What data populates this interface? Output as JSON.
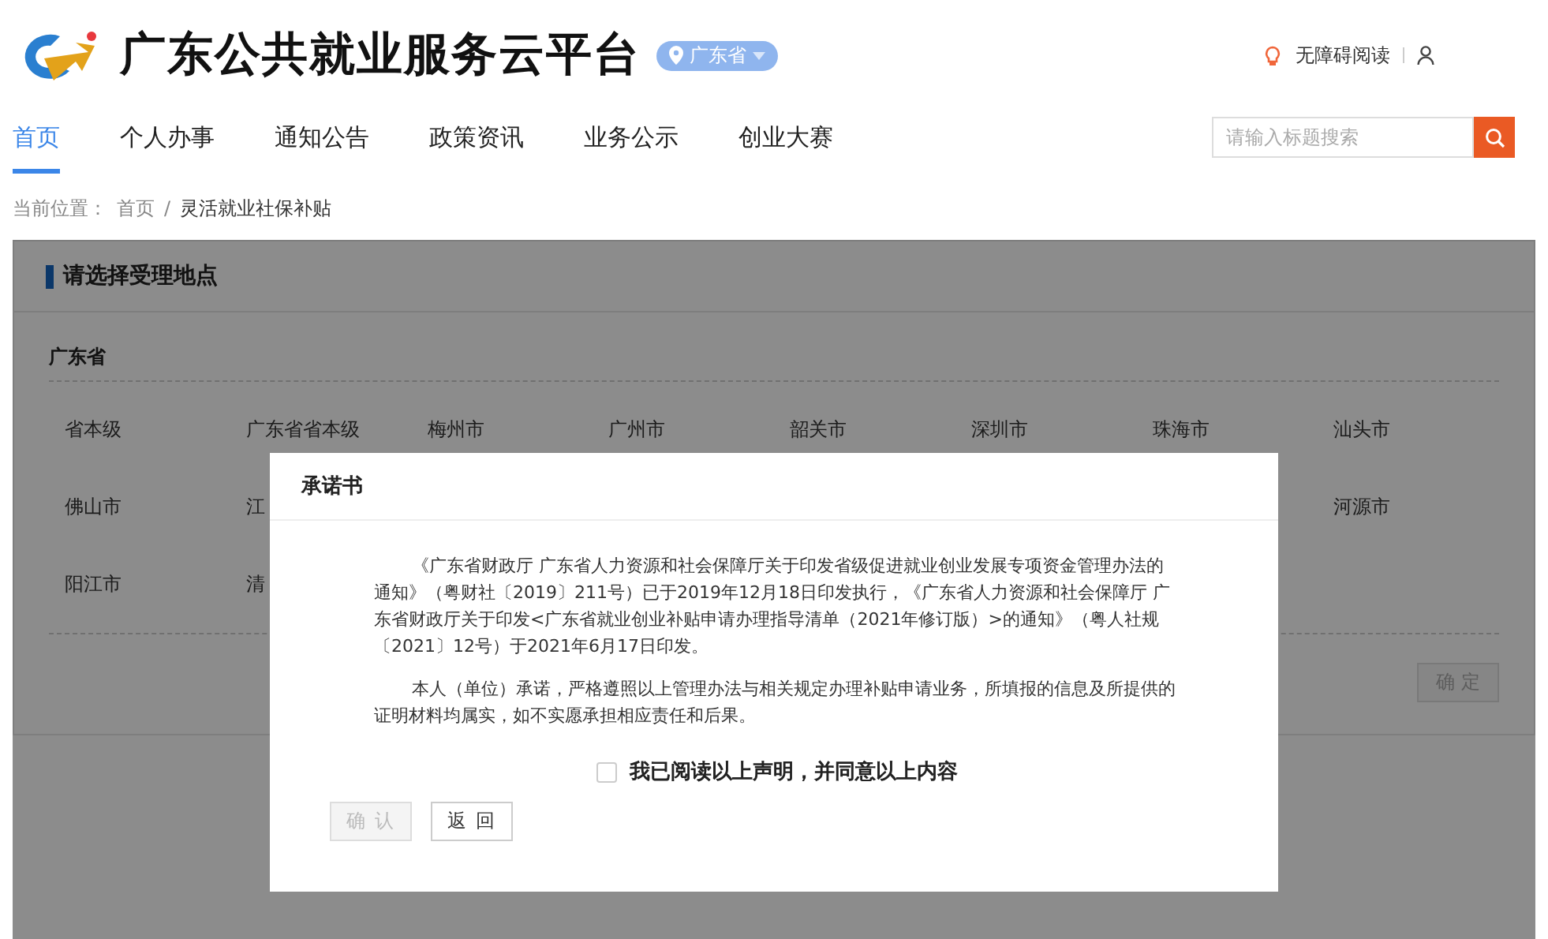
{
  "header": {
    "title": "广东公共就业服务云平台",
    "region": "广东省",
    "accessibility": "无障碍阅读"
  },
  "nav": [
    {
      "label": "首页",
      "selected": true
    },
    {
      "label": "个人办事",
      "selected": false
    },
    {
      "label": "通知公告",
      "selected": false
    },
    {
      "label": "政策资讯",
      "selected": false
    },
    {
      "label": "业务公示",
      "selected": false
    },
    {
      "label": "创业大赛",
      "selected": false
    }
  ],
  "search": {
    "placeholder": "请输入标题搜索"
  },
  "breadcrumb": {
    "label": "当前位置：",
    "items": [
      "首页",
      "灵活就业社保补贴"
    ],
    "separator": "/"
  },
  "location_panel": {
    "title": "请选择受理地点",
    "province": "广东省",
    "rows": [
      {
        "left": [
          "省本级",
          "广东省省本级",
          "梅州市",
          "广州市",
          "韶关市",
          "深圳市",
          "珠海市",
          "汕头市"
        ],
        "right": []
      },
      {
        "left": [
          "佛山市",
          "江"
        ],
        "right": [
          "河源市"
        ]
      },
      {
        "left": [
          "阳江市",
          "清"
        ],
        "right": []
      }
    ],
    "confirm": {
      "label": "确 定",
      "disabled": true
    }
  },
  "dialog": {
    "title": "承诺书",
    "paragraphs": [
      "《广东省财政厅 广东省人力资源和社会保障厅关于印发省级促进就业创业发展专项资金管理办法的通知》（粤财社〔2019〕211号）已于2019年12月18日印发执行，《广东省人力资源和社会保障厅 广东省财政厅关于印发<广东省就业创业补贴申请办理指导清单（2021年修订版）>的通知》（粤人社规〔2021〕12号）于2021年6月17日印发。",
      "本人（单位）承诺，严格遵照以上管理办法与相关规定办理补贴申请业务，所填报的信息及所提供的证明材料均属实，如不实愿承担相应责任和后果。"
    ],
    "agree": {
      "label": "我已阅读以上声明，并同意以上内容",
      "checked": false
    },
    "buttons": [
      {
        "label": "确 认",
        "disabled": true
      },
      {
        "label": "返 回",
        "disabled": false
      }
    ]
  }
}
